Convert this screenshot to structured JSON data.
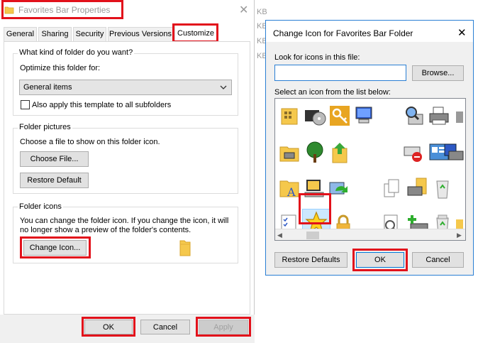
{
  "props_window": {
    "title": "Favorites Bar Properties",
    "tabs": [
      "General",
      "Sharing",
      "Security",
      "Previous Versions",
      "Customize"
    ],
    "folder_type": {
      "group_label": "What kind of folder do you want?",
      "optimize_label": "Optimize this folder for:",
      "selected": "General items",
      "apply_template_label": "Also apply this template to all subfolders"
    },
    "folder_pictures": {
      "group_label": "Folder pictures",
      "description": "Choose a file to show on this folder icon.",
      "choose_file": "Choose File...",
      "restore_default": "Restore Default"
    },
    "folder_icons": {
      "group_label": "Folder icons",
      "description_line1": "You can change the folder icon. If you change the icon, it will",
      "description_line2": "no longer show a preview of the folder's contents.",
      "change_icon": "Change Icon..."
    },
    "buttons": {
      "ok": "OK",
      "cancel": "Cancel",
      "apply": "Apply"
    }
  },
  "background_list": [
    "KB",
    "KB",
    "KB",
    "KB"
  ],
  "change_icon_dialog": {
    "title": "Change Icon for Favorites Bar Folder",
    "look_label": "Look for icons in this file:",
    "file_value": "",
    "browse": "Browse...",
    "select_label": "Select an icon from the list below:",
    "icons": [
      "folder-grid-icon",
      "camera-cd-icon",
      "key-icon",
      "computer-tools-icon",
      "empty-icon",
      "magnifier-computer-icon",
      "printer-icon",
      "partial-icon",
      "folder-printer-icon",
      "tree-icon",
      "upload-folder-icon",
      "empty-icon",
      "no-access-icon",
      "control-panel-icon",
      "printer-floppy-icon",
      "partial-icon",
      "font-folder-icon",
      "network-computer-icon",
      "sync-icon",
      "empty-icon",
      "documents-icon",
      "printer-folder-icon",
      "recycle-bin-icon",
      "partial-icon",
      "checklist-icon",
      "star-icon",
      "lock-icon",
      "empty-icon",
      "search-document-icon",
      "add-printer-icon",
      "recycle-bin-full-icon",
      "partial-icon"
    ],
    "buttons": {
      "restore_defaults": "Restore Defaults",
      "ok": "OK",
      "cancel": "Cancel"
    },
    "close_icon": "close-icon"
  },
  "colors": {
    "highlight": "#e2111b",
    "titlebar_text": "#000000",
    "folder": "#f5c84c",
    "selected_bg": "#cce8ff"
  }
}
